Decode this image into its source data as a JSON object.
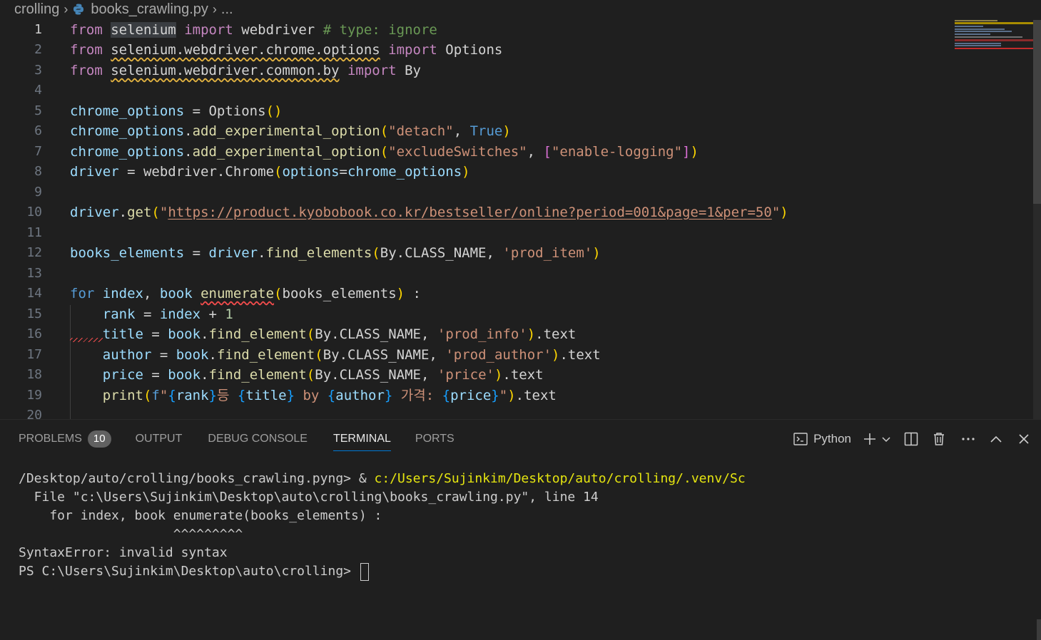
{
  "breadcrumb": {
    "folder": "crolling",
    "file": "books_crawling.py",
    "more": "..."
  },
  "editor": {
    "active_line": 1,
    "line_numbers": [
      "1",
      "2",
      "3",
      "4",
      "5",
      "6",
      "7",
      "8",
      "9",
      "10",
      "11",
      "12",
      "13",
      "14",
      "15",
      "16",
      "17",
      "18",
      "19",
      "20"
    ],
    "lines": {
      "l1": {
        "from": "from",
        "mod": "selenium",
        "import": "import",
        "name": "webdriver",
        "comment": "# type: ignore"
      },
      "l2": {
        "from": "from",
        "mod": "selenium.webdriver.chrome.options",
        "import": "import",
        "name": "Options"
      },
      "l3": {
        "from": "from",
        "mod": "selenium.webdriver.common.by",
        "import": "import",
        "name": "By"
      },
      "l5": {
        "var": "chrome_options",
        "eq": " = ",
        "cls": "Options",
        "paren": "()"
      },
      "l6": {
        "var": "chrome_options",
        "dot": ".",
        "fn": "add_experimental_option",
        "arg1": "\"detach\"",
        "comma": ", ",
        "arg2": "True"
      },
      "l7": {
        "var": "chrome_options",
        "dot": ".",
        "fn": "add_experimental_option",
        "arg1": "\"excludeSwitches\"",
        "comma": ", ",
        "arg2": "\"enable-logging\""
      },
      "l8": {
        "var": "driver",
        "eq": " = ",
        "mod": "webdriver",
        "dot": ".",
        "cls": "Chrome",
        "param": "options",
        "eq2": "=",
        "arg": "chrome_options"
      },
      "l10": {
        "var": "driver",
        "dot": ".",
        "fn": "get",
        "q1": "\"",
        "url": "https://product.kyobobook.co.kr/bestseller/online?period=001&page=1&per=50",
        "q2": "\""
      },
      "l12": {
        "var": "books_elements",
        "eq": " = ",
        "obj": "driver",
        "dot": ".",
        "fn": "find_elements",
        "by": "By",
        "dot2": ".",
        "const": "CLASS_NAME",
        "comma": ", ",
        "arg": "'prod_item'"
      },
      "l14": {
        "for": "for",
        "v1": "index",
        "comma": ", ",
        "v2": "book",
        "fn": "enumerate",
        "arg": "books_elements",
        "colon": " :"
      },
      "l15": {
        "var": "rank",
        "eq": " = ",
        "v": "index",
        "plus": " + ",
        "num": "1"
      },
      "l16": {
        "var": "title",
        "eq": " = ",
        "obj": "book",
        "dot": ".",
        "fn": "find_element",
        "by": "By",
        "dot2": ".",
        "const": "CLASS_NAME",
        "comma": ", ",
        "arg": "'prod_info'",
        "tail": ".text"
      },
      "l17": {
        "var": "author",
        "eq": " = ",
        "obj": "book",
        "dot": ".",
        "fn": "find_element",
        "by": "By",
        "dot2": ".",
        "const": "CLASS_NAME",
        "comma": ", ",
        "arg": "'prod_author'",
        "tail": ".text"
      },
      "l18": {
        "var": "price",
        "eq": " = ",
        "obj": "book",
        "dot": ".",
        "fn": "find_element",
        "by": "By",
        "dot2": ".",
        "const": "CLASS_NAME",
        "comma": ", ",
        "arg": "'price'",
        "tail": ".text"
      },
      "l19": {
        "fn": "print",
        "f": "f",
        "q": "\"",
        "v1": "rank",
        "s1": "등 ",
        "v2": "title",
        "s2": " by ",
        "v3": "author",
        "s3": " 가격: ",
        "v4": "price",
        "q2": "\"",
        "tail": ".text"
      }
    }
  },
  "panel": {
    "tabs": [
      {
        "label": "PROBLEMS",
        "badge": "10"
      },
      {
        "label": "OUTPUT"
      },
      {
        "label": "DEBUG CONSOLE"
      },
      {
        "label": "TERMINAL",
        "active": true
      },
      {
        "label": "PORTS"
      }
    ],
    "toolbar": {
      "shell_label": "Python",
      "icons": [
        "terminal-icon",
        "plus-icon",
        "chevron-down-icon",
        "split-icon",
        "trash-icon",
        "more-icon",
        "chevron-up-icon",
        "close-icon"
      ]
    },
    "terminal": {
      "line1_prefix": "/Desktop/auto/crolling/books_crawling.pyng> & ",
      "line1_path": "c:/Users/Sujinkim/Desktop/auto/crolling/.venv/Sc",
      "line2": "  File \"c:\\Users\\Sujinkim\\Desktop\\auto\\crolling\\books_crawling.py\", line 14",
      "line3": "    for index, book enumerate(books_elements) :",
      "line4": "                    ^^^^^^^^^",
      "line5": "SyntaxError: invalid syntax",
      "line6": "PS C:\\Users\\Sujinkim\\Desktop\\auto\\crolling> "
    }
  },
  "colors": {
    "background": "#1f1f1f",
    "keyword": "#c586c0",
    "variable": "#9cdcfe",
    "function": "#dcdcaa",
    "string": "#ce9178",
    "comment": "#6a9955",
    "terminal_path": "#e5e510",
    "tab_active_underline": "#0078d4"
  }
}
